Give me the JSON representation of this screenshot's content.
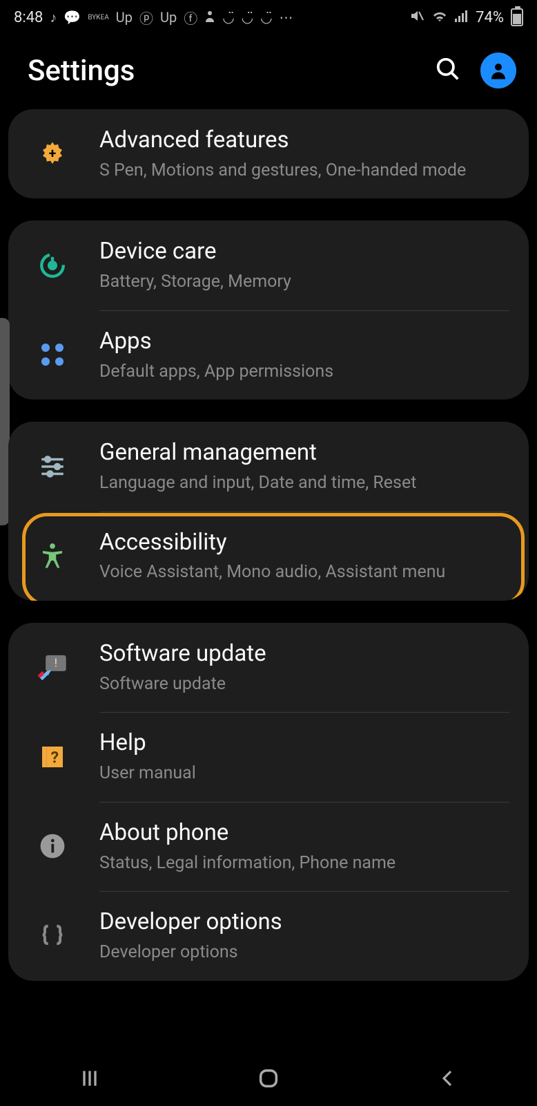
{
  "status": {
    "time": "8:48",
    "battery_pct": "74%",
    "icons_left": [
      "music-note",
      "chat",
      "bykea",
      "up",
      "pinterest",
      "up",
      "facebook",
      "person",
      "smile",
      "smile",
      "smile",
      "more"
    ],
    "icons_right": [
      "mute-vibrate",
      "wifi",
      "signal"
    ]
  },
  "header": {
    "title": "Settings"
  },
  "groups": [
    {
      "items": [
        {
          "icon": "gear-plus-icon",
          "title": "Advanced features",
          "sub": "S Pen, Motions and gestures, One-handed mode"
        }
      ]
    },
    {
      "items": [
        {
          "icon": "device-care-icon",
          "title": "Device care",
          "sub": "Battery, Storage, Memory"
        },
        {
          "icon": "apps-icon",
          "title": "Apps",
          "sub": "Default apps, App permissions"
        }
      ]
    },
    {
      "items": [
        {
          "icon": "sliders-icon",
          "title": "General management",
          "sub": "Language and input, Date and time, Reset"
        },
        {
          "icon": "accessibility-icon",
          "title": "Accessibility",
          "sub": "Voice Assistant, Mono audio, Assistant menu",
          "highlighted": true
        }
      ]
    },
    {
      "items": [
        {
          "icon": "update-icon",
          "title": "Software update",
          "sub": "Software update"
        },
        {
          "icon": "help-icon",
          "title": "Help",
          "sub": "User manual"
        },
        {
          "icon": "info-icon",
          "title": "About phone",
          "sub": "Status, Legal information, Phone name"
        },
        {
          "icon": "braces-icon",
          "title": "Developer options",
          "sub": "Developer options"
        }
      ]
    }
  ],
  "annotation": {
    "target": "Accessibility"
  }
}
